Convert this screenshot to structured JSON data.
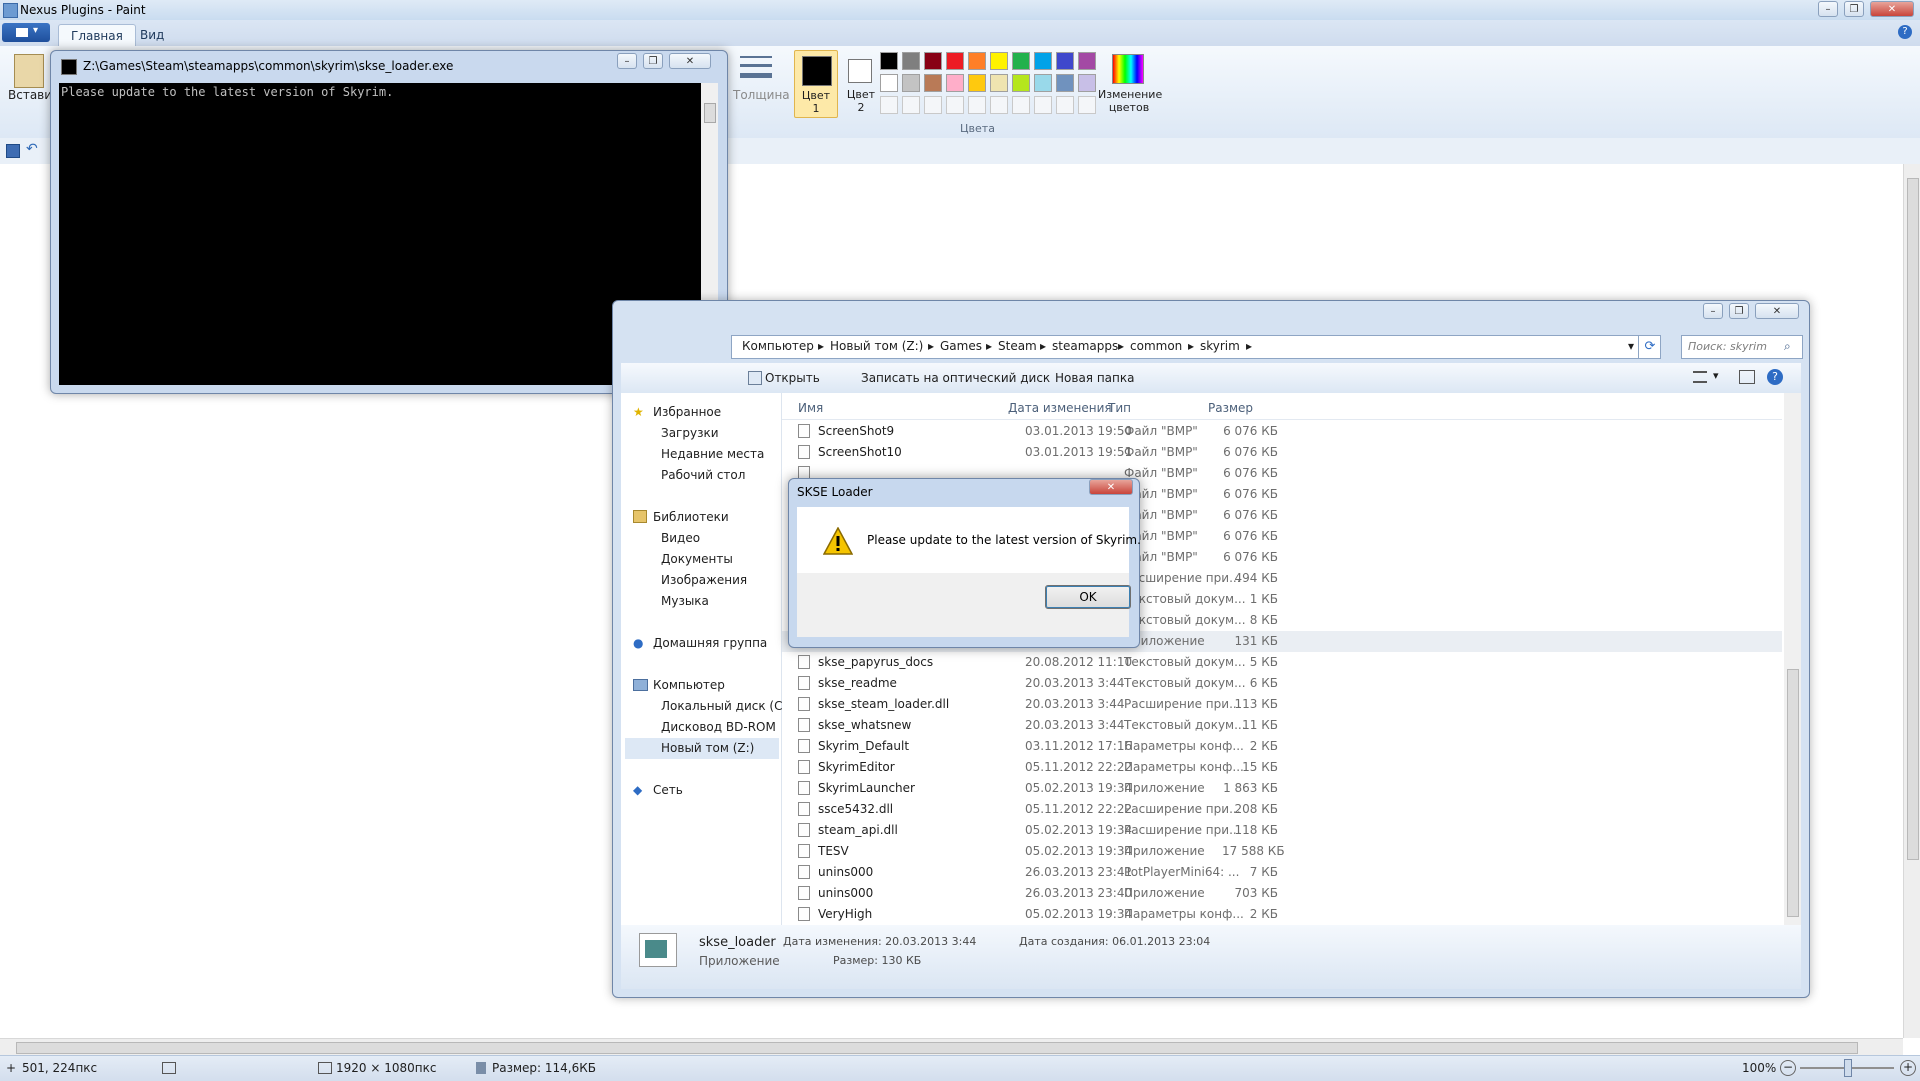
{
  "paint": {
    "title": "Nexus Plugins - Paint",
    "tabs": [
      "Главная",
      "Вид"
    ],
    "paste_label": "Вставить",
    "thickness_label": "Толщина",
    "color1_label": "Цвет 1",
    "color2_label": "Цвет 2",
    "edit_colors_label": "Изменение цветов",
    "colors_group_label": "Цвета",
    "status": {
      "coords": "501, 224пкс",
      "canvas_size": "1920 × 1080пкс",
      "file_size": "Размер: 114,6КБ",
      "zoom": "100%"
    },
    "palette_row1": [
      "#000000",
      "#7f7f7f",
      "#880015",
      "#ed1c24",
      "#ff7f27",
      "#fff200",
      "#22b14c",
      "#00a2e8",
      "#3f48cc",
      "#a349a4"
    ],
    "palette_row2": [
      "#ffffff",
      "#c3c3c3",
      "#b97a57",
      "#ffaec9",
      "#ffc90e",
      "#efe4b0",
      "#b5e61d",
      "#99d9ea",
      "#7092be",
      "#c8bfe7"
    ]
  },
  "console": {
    "title": "Z:\\Games\\Steam\\steamapps\\common\\skyrim\\skse_loader.exe",
    "text": "Please update to the latest version of Skyrim."
  },
  "explorer": {
    "breadcrumbs": [
      "Компьютер",
      "Новый том (Z:)",
      "Games",
      "Steam",
      "steamapps",
      "common",
      "skyrim"
    ],
    "search_placeholder": "Поиск: skyrim",
    "toolbar": {
      "open": "Открыть",
      "burn": "Записать на оптический диск",
      "new_folder": "Новая папка"
    },
    "columns": {
      "name": "Имя",
      "date": "Дата изменения",
      "type": "Тип",
      "size": "Размер"
    },
    "nav": {
      "favorites": "Избранное",
      "favorites_items": [
        "Загрузки",
        "Недавние места",
        "Рабочий стол"
      ],
      "libraries": "Библиотеки",
      "libraries_items": [
        "Видео",
        "Документы",
        "Изображения",
        "Музыка"
      ],
      "homegroup": "Домашняя группа",
      "computer": "Компьютер",
      "computer_items": [
        "Локальный диск (C",
        "Дисковод BD-ROM",
        "Новый том (Z:)"
      ],
      "network": "Сеть"
    },
    "rows": [
      {
        "name": "ScreenShot9",
        "date": "03.01.2013 19:50",
        "type": "Файл \"BMP\"",
        "size": "6 076 КБ"
      },
      {
        "name": "ScreenShot10",
        "date": "03.01.2013 19:51",
        "type": "Файл \"BMP\"",
        "size": "6 076 КБ"
      },
      {
        "name": "",
        "date": "",
        "type": "Файл \"BMP\"",
        "size": "6 076 КБ"
      },
      {
        "name": "",
        "date": "",
        "type": "Файл \"BMP\"",
        "size": "6 076 КБ"
      },
      {
        "name": "",
        "date": "",
        "type": "Файл \"BMP\"",
        "size": "6 076 КБ"
      },
      {
        "name": "",
        "date": "",
        "type": "Файл \"BMP\"",
        "size": "6 076 КБ"
      },
      {
        "name": "",
        "date": "",
        "type": "Файл \"BMP\"",
        "size": "6 076 КБ"
      },
      {
        "name": "",
        "date": "",
        "type": "Расширение при...",
        "size": "494 КБ"
      },
      {
        "name": "",
        "date": "",
        "type": "Текстовый докум...",
        "size": "1 КБ"
      },
      {
        "name": "",
        "date": "",
        "type": "Текстовый докум...",
        "size": "8 КБ"
      },
      {
        "name": "skse_loader",
        "date": "20.03.2013 3:44",
        "type": "Приложение",
        "size": "131 КБ"
      },
      {
        "name": "skse_papyrus_docs",
        "date": "20.08.2012 11:10",
        "type": "Текстовый докум...",
        "size": "5 КБ"
      },
      {
        "name": "skse_readme",
        "date": "20.03.2013 3:44",
        "type": "Текстовый докум...",
        "size": "6 КБ"
      },
      {
        "name": "skse_steam_loader.dll",
        "date": "20.03.2013 3:44",
        "type": "Расширение при...",
        "size": "113 КБ"
      },
      {
        "name": "skse_whatsnew",
        "date": "20.03.2013 3:44",
        "type": "Текстовый докум...",
        "size": "11 КБ"
      },
      {
        "name": "Skyrim_Default",
        "date": "03.11.2012 17:16",
        "type": "Параметры конф...",
        "size": "2 КБ"
      },
      {
        "name": "SkyrimEditor",
        "date": "05.11.2012 22:22",
        "type": "Параметры конф...",
        "size": "15 КБ"
      },
      {
        "name": "SkyrimLauncher",
        "date": "05.02.2013 19:34",
        "type": "Приложение",
        "size": "1 863 КБ"
      },
      {
        "name": "ssce5432.dll",
        "date": "05.11.2012 22:22",
        "type": "Расширение при...",
        "size": "208 КБ"
      },
      {
        "name": "steam_api.dll",
        "date": "05.02.2013 19:34",
        "type": "Расширение при...",
        "size": "118 КБ"
      },
      {
        "name": "TESV",
        "date": "05.02.2013 19:34",
        "type": "Приложение",
        "size": "17 588 КБ"
      },
      {
        "name": "unins000",
        "date": "26.03.2013 23:41",
        "type": "PotPlayerMini64: ...",
        "size": "7 КБ"
      },
      {
        "name": "unins000",
        "date": "26.03.2013 23:40",
        "type": "Приложение",
        "size": "703 КБ"
      },
      {
        "name": "VeryHigh",
        "date": "05.02.2013 19:34",
        "type": "Параметры конф...",
        "size": "2 КБ"
      }
    ],
    "details": {
      "name": "skse_loader",
      "kind": "Приложение",
      "modified_label": "Дата изменения: 20.03.2013 3:44",
      "size_label": "Размер: 130 КБ",
      "created_label": "Дата создания: 06.01.2013 23:04"
    }
  },
  "dialog": {
    "title": "SKSE Loader",
    "message": "Please update to the latest version of Skyrim.",
    "ok": "OK"
  }
}
